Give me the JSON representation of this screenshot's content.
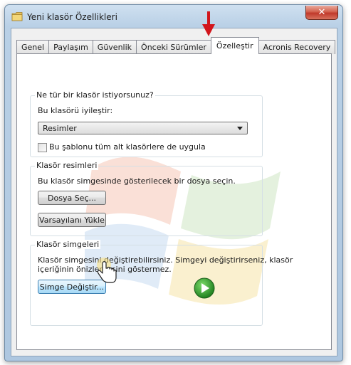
{
  "window": {
    "title": "Yeni klasör Özellikleri",
    "close_label": "✕"
  },
  "tabs": [
    {
      "label": "Genel"
    },
    {
      "label": "Paylaşım"
    },
    {
      "label": "Güvenlik"
    },
    {
      "label": "Önceki Sürümler"
    },
    {
      "label": "Özelleştir"
    },
    {
      "label": "Acronis Recovery"
    }
  ],
  "active_tab": "Özelleştir",
  "group_type": {
    "title": "Ne tür bir klasör istiyorsunuz?",
    "optimize_label": "Bu klasörü iyileştir:",
    "optimize_value": "Resimler",
    "apply_subfolders_label": "Bu şablonu tüm alt klasörlere de uygula",
    "apply_subfolders_checked": false
  },
  "group_pictures": {
    "title": "Klasör resimleri",
    "description": "Bu klasör simgesinde gösterilecek bir dosya seçin.",
    "choose_file_label": "Dosya Seç...",
    "restore_default_label": "Varsayılanı Yükle"
  },
  "group_icons": {
    "title": "Klasör simgeleri",
    "description_line1": "Klasör simgesini değiştirebilirsiniz. Simgeyi değiştirirseniz, klasör",
    "description_line2": "içeriğinin önizlemesini göstermez.",
    "change_icon_label": "Simge Değiştir..."
  },
  "icons": {
    "title_icon": "folder-icon",
    "play": "play-icon",
    "cursor": "hand-cursor-icon",
    "annotation": "red-arrow-icon"
  },
  "colors": {
    "annotation_red": "#d2151b",
    "play_green": "#2e9e2e",
    "button_hover": "#bee6fd"
  }
}
